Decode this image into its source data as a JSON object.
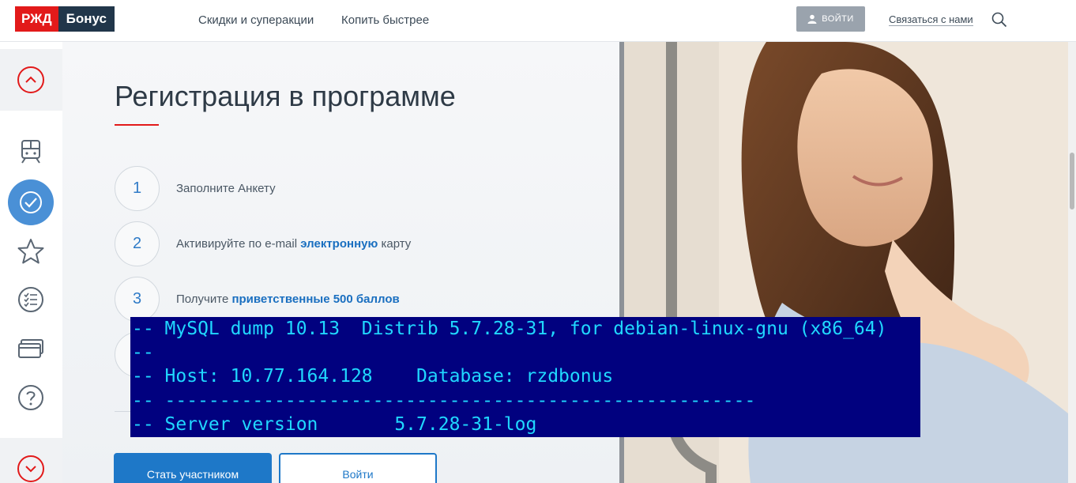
{
  "header": {
    "logo_left": "РЖД",
    "logo_right": "Бонус",
    "nav": [
      {
        "label": "Скидки и суперакции"
      },
      {
        "label": "Копить быстрее"
      }
    ],
    "login_label": "ВОЙТИ",
    "contact_label": "Связаться с нами",
    "search_icon": "search-icon"
  },
  "sidebar": {
    "items": [
      {
        "icon": "chevron-up-icon"
      },
      {
        "icon": "train-icon"
      },
      {
        "icon": "check-circle-icon",
        "active": true
      },
      {
        "icon": "star-icon"
      },
      {
        "icon": "checklist-icon"
      },
      {
        "icon": "cards-icon"
      },
      {
        "icon": "help-icon"
      },
      {
        "icon": "chevron-down-icon"
      }
    ]
  },
  "main": {
    "title": "Регистрация в программе",
    "steps": [
      {
        "number": "1",
        "text": "Заполните Анкету"
      },
      {
        "number": "2",
        "text_before": "Активируйте по e-mail ",
        "link": "электронную",
        "text_after": " карту"
      },
      {
        "number": "3",
        "text_before": "Получите ",
        "link": "приветственные 500 баллов"
      }
    ],
    "join_button": "Стать участником",
    "signin_button": "Войти"
  },
  "terminal": {
    "lines": [
      "-- MySQL dump 10.13  Distrib 5.7.28-31, for debian-linux-gnu (x86_64)",
      "--",
      "-- Host: 10.77.164.128    Database: rzdbonus",
      "-- ------------------------------------------------------",
      "-- Server version       5.7.28-31-log"
    ]
  },
  "colors": {
    "brand_red": "#e21a1a",
    "brand_dark": "#21364a",
    "accent_blue": "#1e78c8",
    "terminal_bg": "#01017f",
    "terminal_text": "#20d8ff"
  }
}
